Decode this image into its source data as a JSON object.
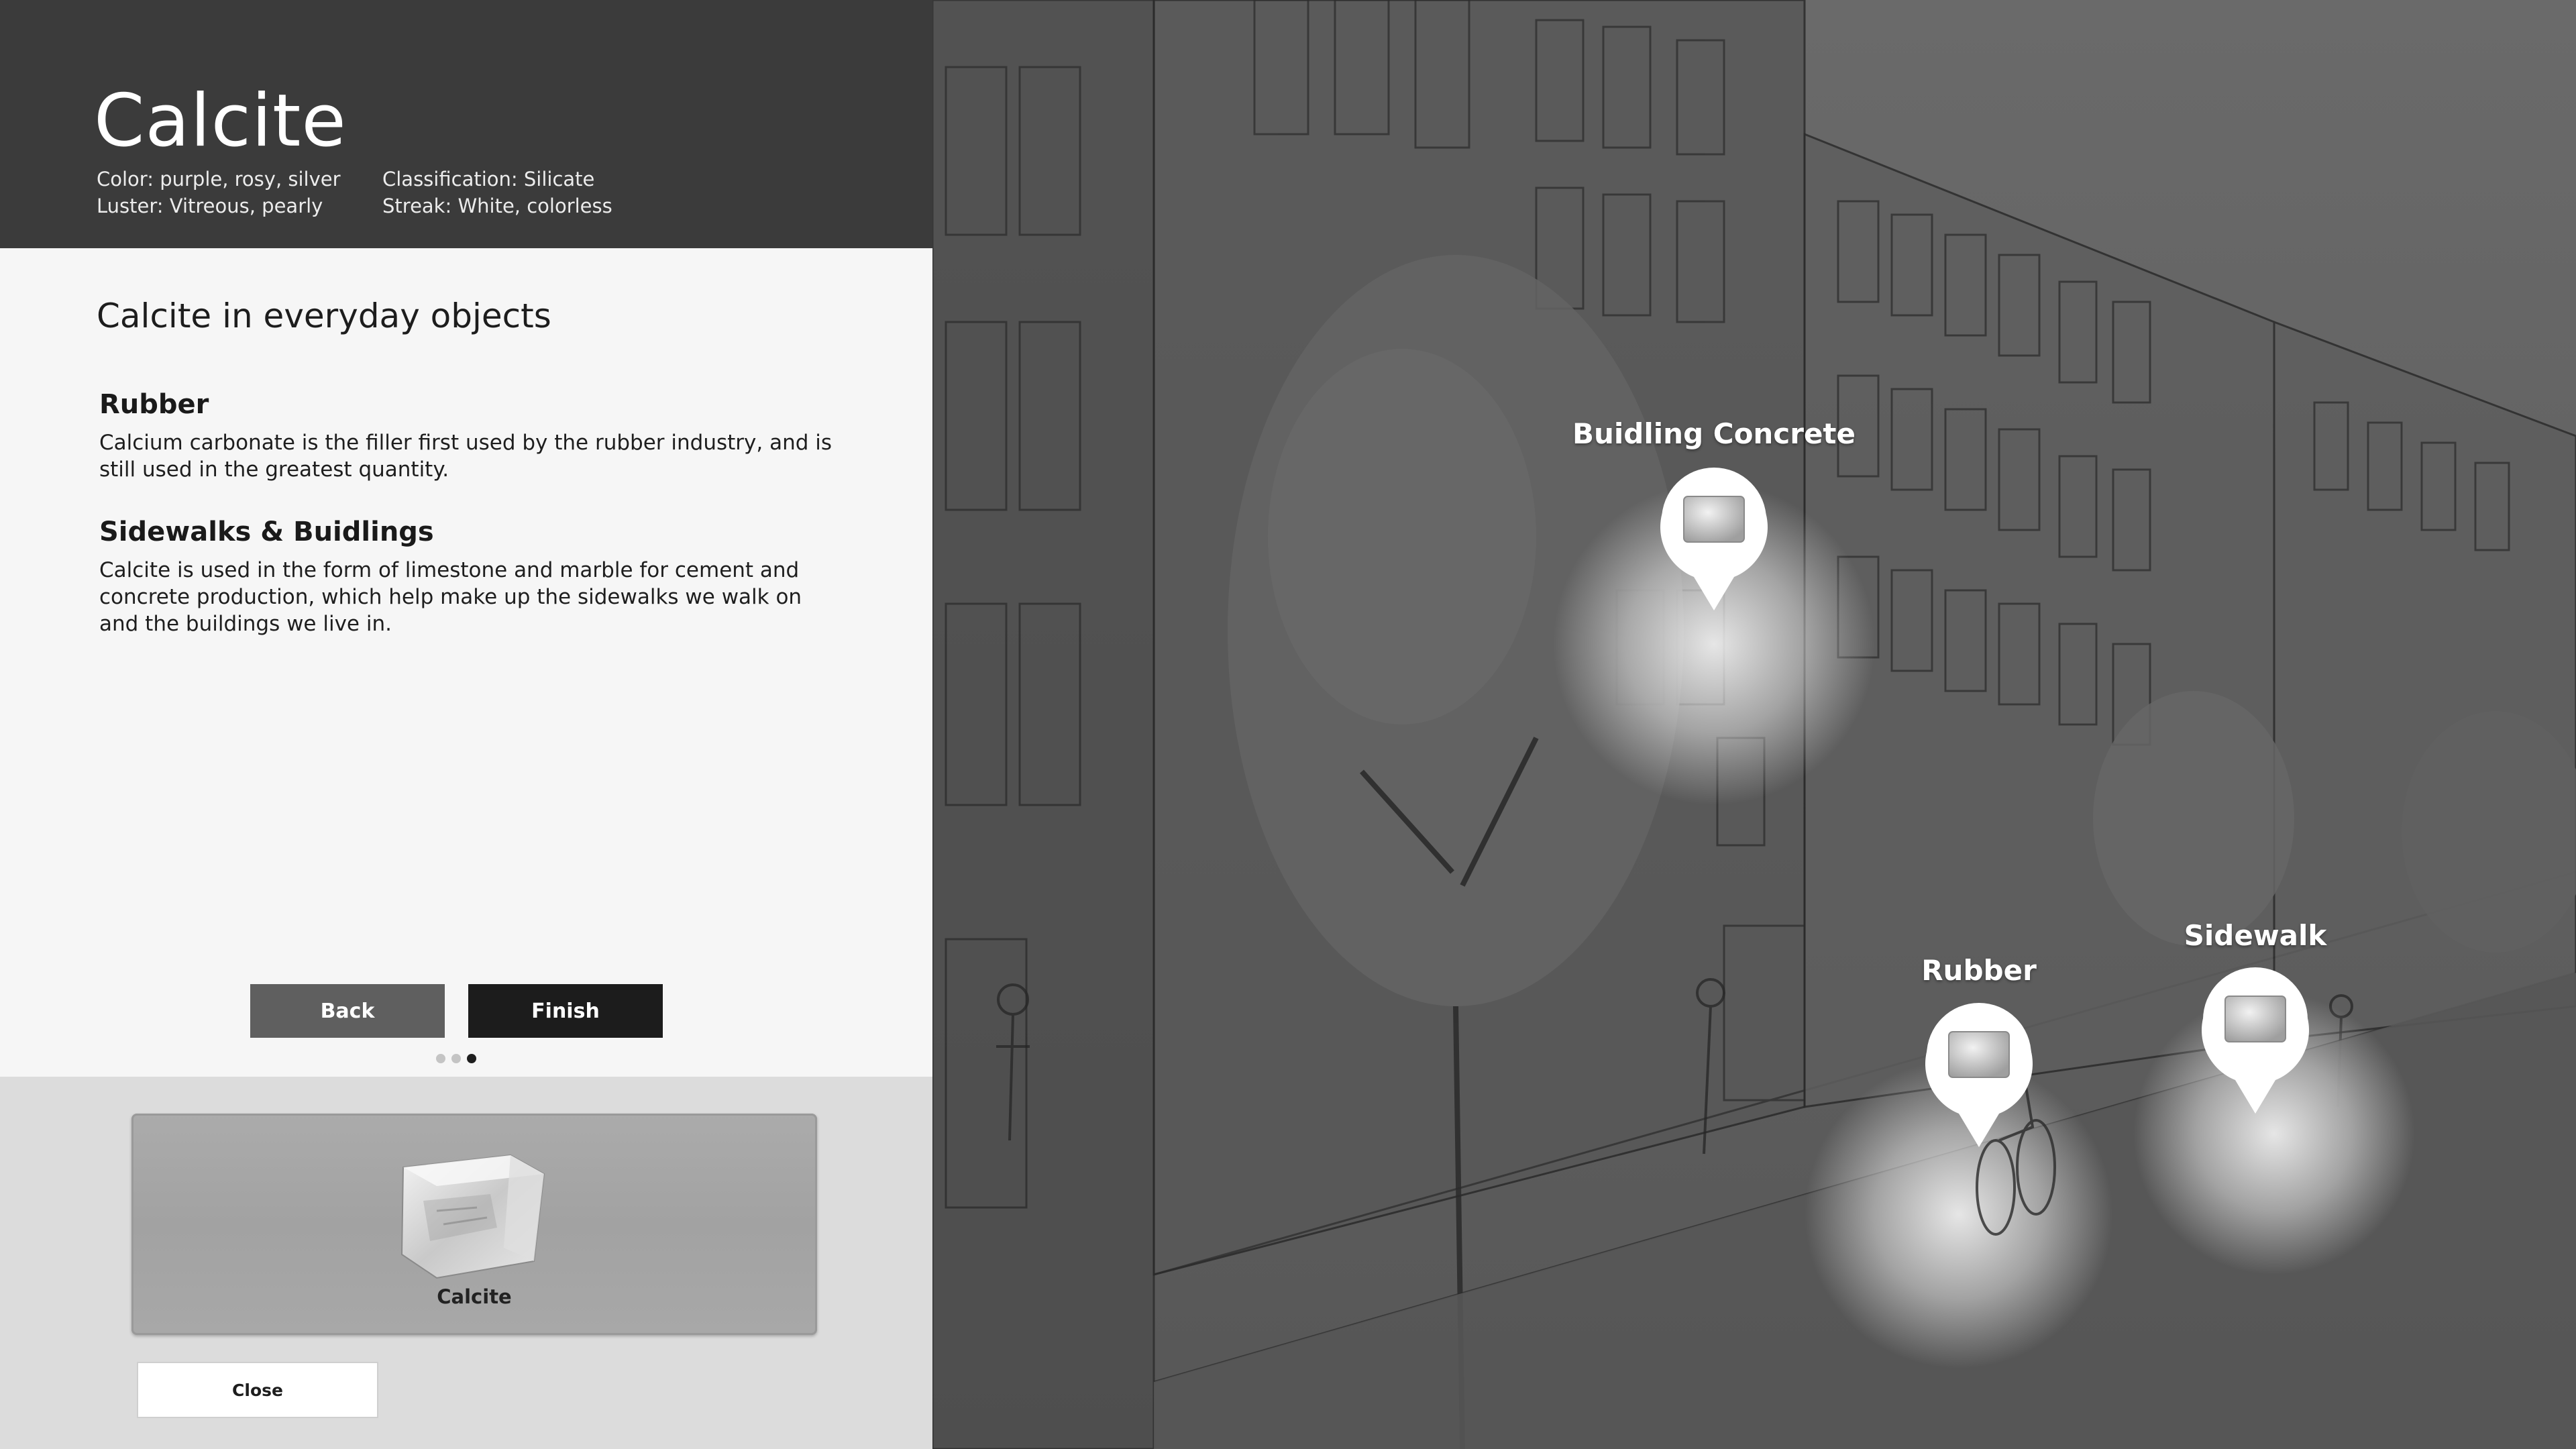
{
  "mineral": {
    "name": "Calcite",
    "color": "Color: purple, rosy, silver",
    "luster": "Luster: Vitreous, pearly",
    "classification": "Classification: Silicate",
    "streak": "Streak: White, colorless"
  },
  "content": {
    "section_title": "Calcite in everyday objects",
    "items": [
      {
        "title": "Rubber",
        "body": "Calcium carbonate is the filler first used by the rubber industry, and is still used in the greatest quantity."
      },
      {
        "title": "Sidewalks & Buidlings",
        "body": "Calcite is used in the form of limestone and marble for cement and concrete production, which help make up the sidewalks we walk on and the buildings we live in."
      }
    ]
  },
  "buttons": {
    "back": "Back",
    "finish": "Finish",
    "close": "Close"
  },
  "pagination": {
    "total": 3,
    "current": 3
  },
  "tray": {
    "card_label": "Calcite"
  },
  "scene": {
    "pins": [
      {
        "label": "Buidling Concrete",
        "icon": "map-pin-icon"
      },
      {
        "label": "Rubber",
        "icon": "map-pin-icon"
      },
      {
        "label": "Sidewalk",
        "icon": "map-pin-icon"
      }
    ]
  }
}
